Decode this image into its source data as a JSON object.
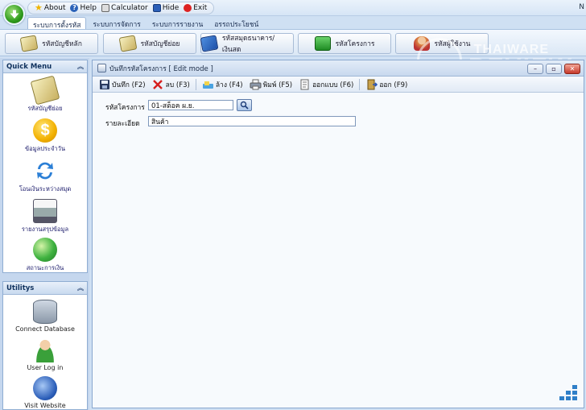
{
  "qat": {
    "about": "About",
    "help": "Help",
    "calculator": "Calculator",
    "hide": "Hide",
    "exit": "Exit"
  },
  "top_right_text": "N",
  "tabs": [
    {
      "label": "ระบบการตั้งรหัส",
      "active": true
    },
    {
      "label": "ระบบการจัดการ"
    },
    {
      "label": "ระบบการรายงาน"
    },
    {
      "label": "อรรถประโยชน์"
    }
  ],
  "ribbon": [
    {
      "label": "รหัสบัญชีหลัก"
    },
    {
      "label": "รหัสบัญชีย่อย"
    },
    {
      "label": "รหัสสมุดธนาคาร/เงินสด"
    },
    {
      "label": "รหัสโครงการ"
    },
    {
      "label": "รหัสผู้ใช้งาน"
    }
  ],
  "watermark": {
    "line1": "THAIWARE",
    "line2": "REVIEW"
  },
  "quick_menu": {
    "title": "Quick Menu",
    "items": [
      {
        "label": "รหัสบัญชีย่อย"
      },
      {
        "label": "ข้อมูลประจำวัน"
      },
      {
        "label": "โอนเงินระหว่างสมุด"
      },
      {
        "label": "รายงานสรุปข้อมูล"
      },
      {
        "label": "สถานะการเงิน"
      }
    ]
  },
  "utility": {
    "title": "Utilitys",
    "items": [
      {
        "label": "Connect Database"
      },
      {
        "label": "User Log in"
      },
      {
        "label": "Visit Website"
      }
    ]
  },
  "window": {
    "title": "บันทึกรหัสโครงการ [ Edit mode ]",
    "toolbar": {
      "save": "บันทึก (F2)",
      "delete": "ลบ (F3)",
      "clear": "ล้าง (F4)",
      "print": "พิมพ์ (F5)",
      "design": "ออกแบบ (F6)",
      "exit": "ออก (F9)"
    },
    "form": {
      "code_label": "รหัสโครงการ",
      "code_value": "01-สต็อค ผ.ย.",
      "detail_label": "รายละเอียด",
      "detail_value": "สินค้า"
    }
  }
}
